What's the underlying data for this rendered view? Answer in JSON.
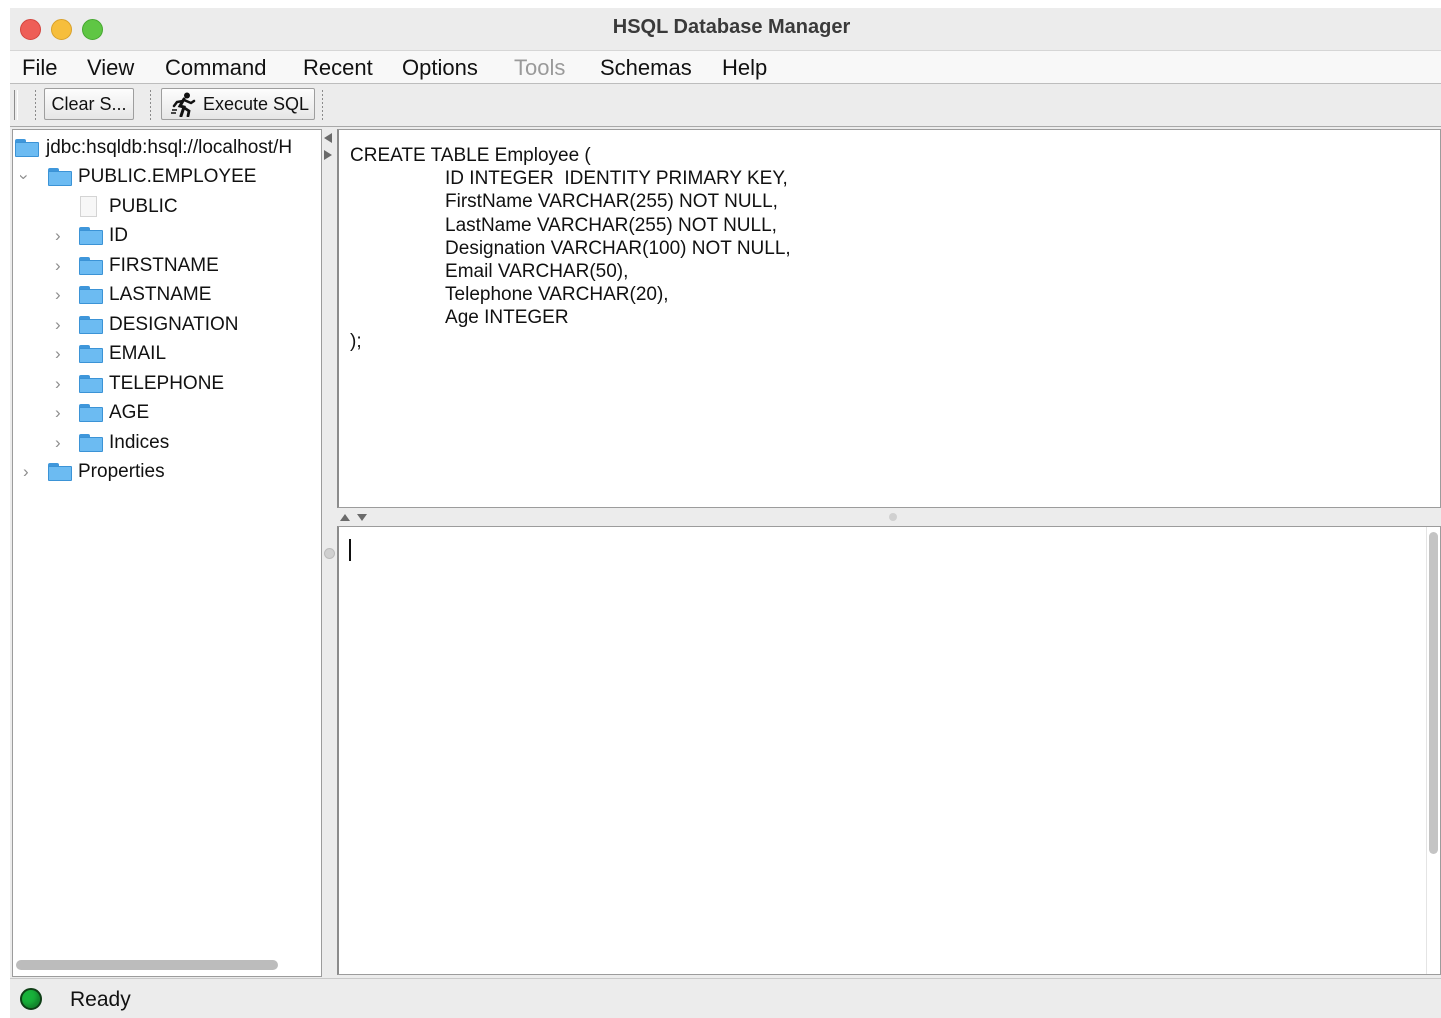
{
  "window": {
    "title": "HSQL Database Manager"
  },
  "menubar": [
    {
      "label": "File",
      "enabled": true
    },
    {
      "label": "View",
      "enabled": true
    },
    {
      "label": "Command",
      "enabled": true
    },
    {
      "label": "Recent",
      "enabled": true
    },
    {
      "label": "Options",
      "enabled": true
    },
    {
      "label": "Tools",
      "enabled": false
    },
    {
      "label": "Schemas",
      "enabled": true
    },
    {
      "label": "Help",
      "enabled": true
    }
  ],
  "toolbar": {
    "clear_label": "Clear S...",
    "execute_label": "Execute SQL"
  },
  "tree": {
    "root": "jdbc:hsqldb:hsql://localhost/H",
    "table": "PUBLIC.EMPLOYEE",
    "schema": "PUBLIC",
    "columns": [
      "ID",
      "FIRSTNAME",
      "LASTNAME",
      "DESIGNATION",
      "EMAIL",
      "TELEPHONE",
      "AGE",
      "Indices"
    ],
    "properties": "Properties"
  },
  "editor": {
    "lines": [
      "CREATE TABLE Employee (",
      "\t\t\tID INTEGER  IDENTITY PRIMARY KEY,",
      "\t\t\tFirstName VARCHAR(255) NOT NULL,",
      "\t\t\tLastName VARCHAR(255) NOT NULL,",
      "\t\t\tDesignation VARCHAR(100) NOT NULL,",
      "\t\t\tEmail VARCHAR(50),",
      "\t\t\tTelephone VARCHAR(20),",
      "\t\t\tAge INTEGER",
      ");"
    ]
  },
  "status": {
    "text": "Ready",
    "light_color": "#18b13a"
  }
}
